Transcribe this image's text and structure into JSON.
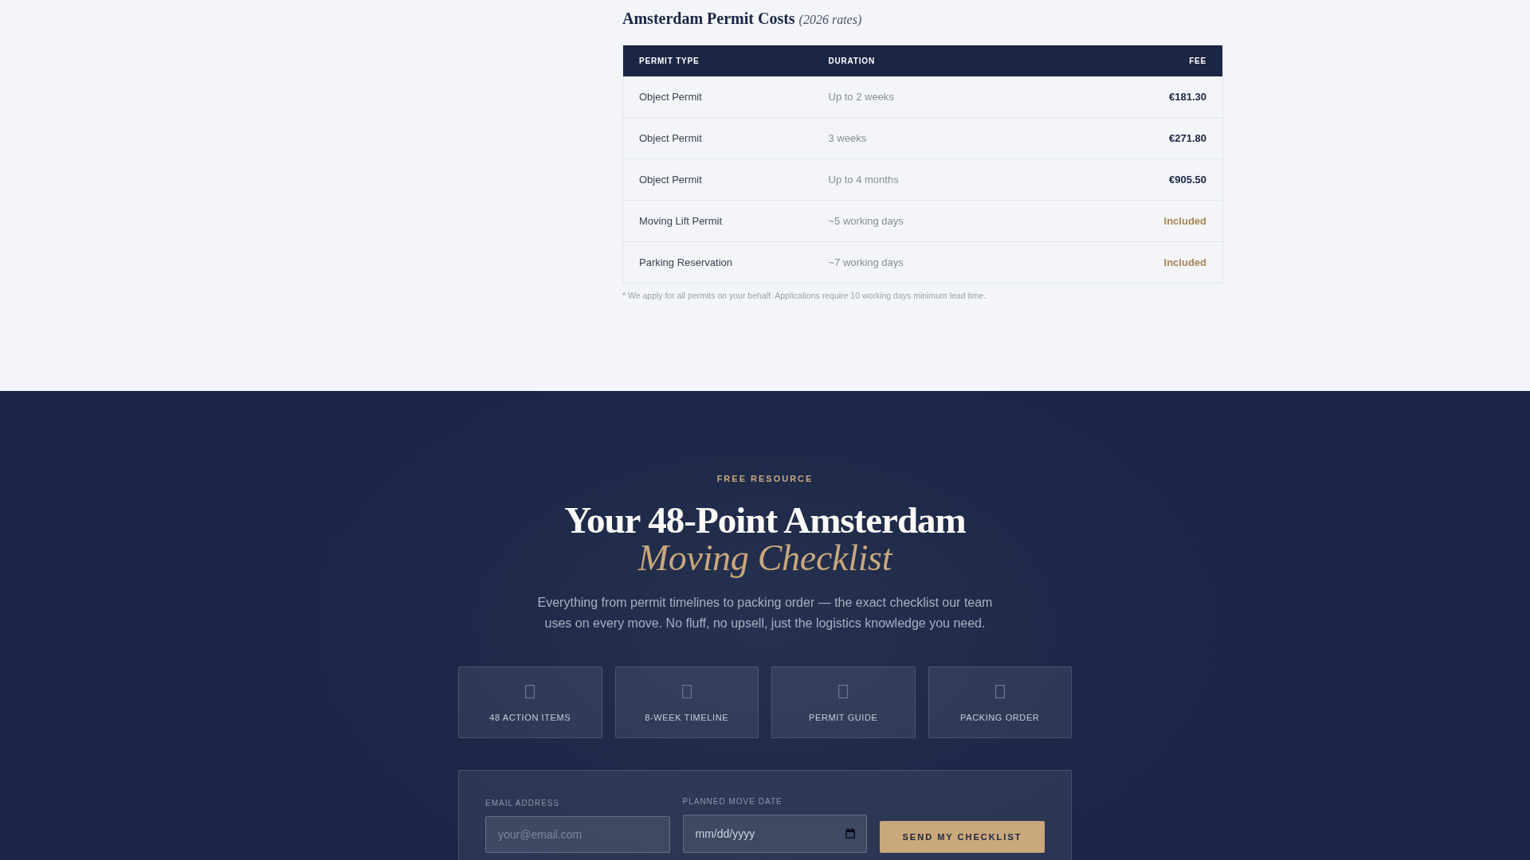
{
  "permit_costs": {
    "title": "Amsterdam Permit Costs *(2026 rates)*",
    "columns": [
      "PERMIT TYPE",
      "DURATION",
      "FEE"
    ],
    "rows": [
      {
        "permit_type": "Object Permit",
        "duration": "Up to 2 weeks",
        "fee": "€181.30",
        "kind": "price"
      },
      {
        "permit_type": "Object Permit",
        "duration": "3 weeks",
        "fee": "€271.80",
        "kind": "price"
      },
      {
        "permit_type": "Object Permit",
        "duration": "Up to 4 months",
        "fee": "€905.50",
        "kind": "price"
      },
      {
        "permit_type": "Moving Lift Permit",
        "duration": "~5 working days",
        "fee": "Included",
        "kind": "included"
      },
      {
        "permit_type": "Parking Reservation",
        "duration": "~7 working days",
        "fee": "Included",
        "kind": "included"
      }
    ],
    "footnote": "* We apply for all permits on your behalf. Applications require 10 working days minimum lead time."
  },
  "checklist": {
    "eyebrow": "FREE RESOURCE",
    "heading": "Your 48-Point Amsterdam",
    "heading_accent": "Moving Checklist",
    "description": "Everything from permit timelines to packing order — the exact checklist our team uses on every move. No fluff, no upsell, just the logistics knowledge you need.",
    "features": [
      {
        "label": "48 ACTION ITEMS"
      },
      {
        "label": "8-WEEK TIMELINE"
      },
      {
        "label": "PERMIT GUIDE"
      },
      {
        "label": "PACKING ORDER"
      }
    ],
    "form": {
      "fields": [
        {
          "kind": "email",
          "label": "EMAIL ADDRESS",
          "placeholder": "your@email.com"
        },
        {
          "kind": "date",
          "label": "PLANNED MOVE DATE",
          "placeholder": "mm/dd/yyyy"
        }
      ],
      "button": "SEND MY CHECKLIST"
    }
  }
}
